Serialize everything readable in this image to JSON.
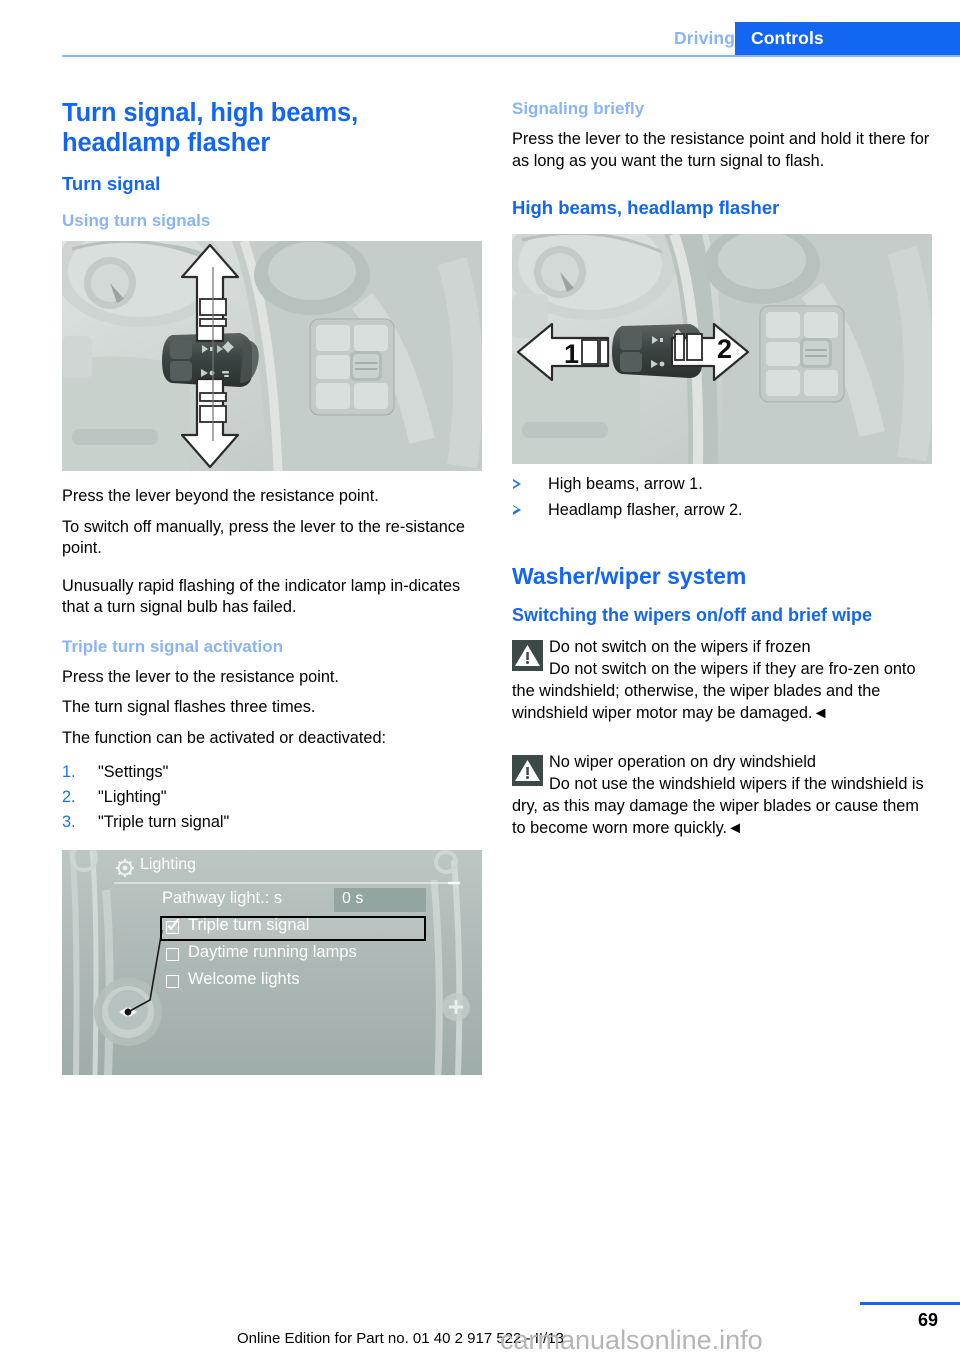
{
  "header": {
    "tab_inactive": "Driving",
    "tab_active": "Controls",
    "accent_blue": "#1266f1",
    "light_blue": "#8ab4f8"
  },
  "left_column": {
    "chapter_title": "Turn signal, high beams, headlamp flasher",
    "section_title": "Turn signal",
    "subsection_title": "Using turn signals",
    "figure_turn_signal": {
      "alt": "Steering column turn signal lever with up and down arrows",
      "arrows": [
        "up",
        "down"
      ]
    },
    "paragraphs": [
      "Press the lever beyond the resistance point.",
      "To switch off manually, press the lever to the re-sistance point.",
      "Unusually rapid flashing of the indicator lamp in-dicates that a turn signal bulb has failed."
    ],
    "triple_heading": "Triple turn signal activation",
    "triple_paragraphs": [
      "Press the lever to the resistance point.",
      "The turn signal flashes three times.",
      "The function can be activated or deactivated:"
    ],
    "steps": [
      {
        "num": "1.",
        "label": "\"Settings\""
      },
      {
        "num": "2.",
        "label": "\"Lighting\""
      },
      {
        "num": "3.",
        "label": "\"Triple turn signal\""
      }
    ],
    "idrive": {
      "title": "Lighting",
      "gear_icon": "gear-icon",
      "rows": [
        {
          "label": "Pathway light.: s",
          "value": "0 s",
          "type": "value"
        },
        {
          "label": "Triple turn signal",
          "checked": true,
          "selected": true,
          "type": "checkbox"
        },
        {
          "label": "Daytime running lamps",
          "checked": false,
          "selected": false,
          "type": "checkbox"
        },
        {
          "label": "Welcome lights",
          "checked": false,
          "selected": false,
          "type": "checkbox"
        }
      ]
    }
  },
  "right_column": {
    "signaling_heading": "Signaling briefly",
    "signaling_text": "Press the lever to the resistance point and hold it there for as long as you want the turn signal to flash.",
    "highbeam_heading": "High beams, headlamp flasher",
    "figure_high_beams": {
      "alt": "Steering column lever with arrows 1 and 2",
      "arrow_labels": [
        "1",
        "2"
      ]
    },
    "bullets": [
      "High beams, arrow 1.",
      "Headlamp flasher, arrow 2."
    ],
    "washer_heading": "Washer/wiper system",
    "wiper_subheading": "Switching the wipers on/off and brief wipe",
    "warnings": [
      {
        "icon": "warning-triangle-icon",
        "title": "Do not switch on the wipers if frozen",
        "body": "Do not switch on the wipers if they are fro-zen onto the windshield; otherwise, the wiper blades and the windshield wiper motor may be damaged.◄"
      },
      {
        "icon": "warning-triangle-icon",
        "title": "No wiper operation on dry windshield",
        "body": "Do not use the windshield wipers if the windshield is dry, as this may damage the wiper blades or cause them to become worn more quickly.◄"
      }
    ]
  },
  "footer": {
    "edition": "Online Edition for Part no. 01 40 2 917 522 - II/13",
    "page_number": "69",
    "watermark": "carmanualsonline.info"
  }
}
